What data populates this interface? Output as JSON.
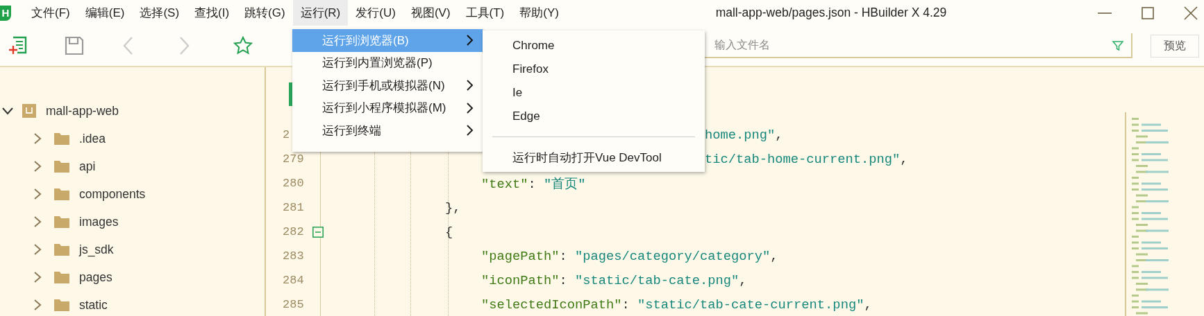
{
  "window": {
    "logo": "H",
    "title": "mall-app-web/pages.json - HBuilder X 4.29"
  },
  "menu_bar": [
    {
      "label": "文件(F)",
      "selected": false
    },
    {
      "label": "编辑(E)",
      "selected": false
    },
    {
      "label": "选择(S)",
      "selected": false
    },
    {
      "label": "查找(I)",
      "selected": false
    },
    {
      "label": "跳转(G)",
      "selected": false
    },
    {
      "label": "运行(R)",
      "selected": true
    },
    {
      "label": "发行(U)",
      "selected": false
    },
    {
      "label": "视图(V)",
      "selected": false
    },
    {
      "label": "工具(T)",
      "selected": false
    },
    {
      "label": "帮助(Y)",
      "selected": false
    }
  ],
  "toolbar": {
    "file_search": {
      "placeholder": "输入文件名"
    },
    "preview_button": "预览"
  },
  "project_tree": {
    "label": "mall-app-web",
    "expanded": true,
    "children": [
      {
        "label": ".idea",
        "expanded": false
      },
      {
        "label": "api",
        "expanded": false
      },
      {
        "label": "components",
        "expanded": false
      },
      {
        "label": "images",
        "expanded": false
      },
      {
        "label": "js_sdk",
        "expanded": false
      },
      {
        "label": "pages",
        "expanded": false
      },
      {
        "label": "static",
        "expanded": false
      }
    ]
  },
  "editor": {
    "lines": [
      {
        "number": "2",
        "kind": "cut_property",
        "fold_marker": false,
        "tokens": [
          {
            "kind": "string",
            "text": "home.png\""
          },
          {
            "kind": "punct",
            "text": ","
          }
        ]
      },
      {
        "number": "279",
        "kind": "cut_property",
        "fold_marker": false,
        "tokens": [
          {
            "kind": "string",
            "text": "tic/tab-home-current.png\""
          },
          {
            "kind": "punct",
            "text": ","
          }
        ]
      },
      {
        "number": "280",
        "kind": "property",
        "fold_marker": false,
        "tokens": [
          {
            "kind": "key",
            "text": "\"text\""
          },
          {
            "kind": "punct",
            "text": ":"
          },
          {
            "kind": "string",
            "text": "\"首页\""
          }
        ]
      },
      {
        "number": "281",
        "kind": "brace",
        "fold_marker": false,
        "tokens": [
          {
            "kind": "punct",
            "text": "},"
          }
        ]
      },
      {
        "number": "282",
        "kind": "brace",
        "fold_marker": true,
        "tokens": [
          {
            "kind": "punct",
            "text": "{"
          }
        ]
      },
      {
        "number": "283",
        "kind": "property",
        "fold_marker": false,
        "tokens": [
          {
            "kind": "key",
            "text": "\"pagePath\""
          },
          {
            "kind": "punct",
            "text": ":"
          },
          {
            "kind": "string",
            "text": "\"pages/category/category\""
          },
          {
            "kind": "punct",
            "text": ","
          }
        ]
      },
      {
        "number": "284",
        "kind": "property",
        "fold_marker": false,
        "tokens": [
          {
            "kind": "key",
            "text": "\"iconPath\""
          },
          {
            "kind": "punct",
            "text": ":"
          },
          {
            "kind": "string",
            "text": "\"static/tab-cate.png\""
          },
          {
            "kind": "punct",
            "text": ","
          }
        ]
      },
      {
        "number": "285",
        "kind": "property",
        "fold_marker": false,
        "tokens": [
          {
            "kind": "key",
            "text": "\"selectedIconPath\""
          },
          {
            "kind": "punct",
            "text": ":"
          },
          {
            "kind": "string",
            "text": "\"static/tab-cate-current.png\""
          },
          {
            "kind": "punct",
            "text": ","
          }
        ]
      }
    ]
  },
  "run_menu": {
    "items": [
      {
        "label": "运行到浏览器(B)",
        "selected": true,
        "submenu": true
      },
      {
        "label": "运行到内置浏览器(P)",
        "selected": false,
        "submenu": false
      },
      {
        "label": "运行到手机或模拟器(N)",
        "selected": false,
        "submenu": true
      },
      {
        "label": "运行到小程序模拟器(M)",
        "selected": false,
        "submenu": true
      },
      {
        "label": "运行到终端",
        "selected": false,
        "submenu": true
      }
    ]
  },
  "browser_submenu": {
    "items": [
      {
        "kind": "item",
        "label": "Chrome"
      },
      {
        "kind": "item",
        "label": "Firefox"
      },
      {
        "kind": "item",
        "label": "Ie"
      },
      {
        "kind": "item",
        "label": "Edge"
      },
      {
        "kind": "separator"
      },
      {
        "kind": "item",
        "label": "运行时自动打开Vue DevTool"
      }
    ]
  }
}
